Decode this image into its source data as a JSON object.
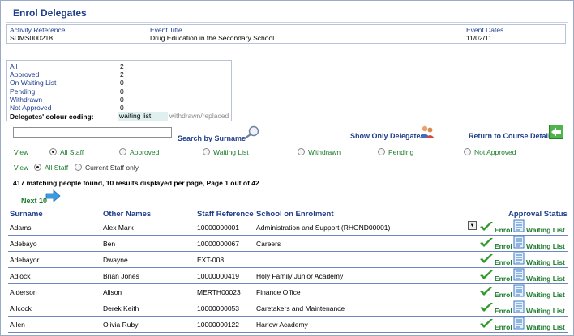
{
  "page": {
    "title": "Enrol Delegates"
  },
  "event": {
    "activity_ref_label": "Activity Reference",
    "activity_ref_value": "SDMS000218",
    "title_label": "Event Title",
    "title_value": "Drug Education in the Secondary School",
    "dates_label": "Event Dates",
    "dates_value": "11/02/11"
  },
  "stats": [
    {
      "label": "All",
      "value": "2"
    },
    {
      "label": "Approved",
      "value": "2"
    },
    {
      "label": "On Waiting List",
      "value": "0"
    },
    {
      "label": "Pending",
      "value": "0"
    },
    {
      "label": "Withdrawn",
      "value": "0"
    },
    {
      "label": "Not Approved",
      "value": "0"
    }
  ],
  "coding": {
    "label": "Delegates' colour coding:",
    "waiting": "waiting list",
    "withdrawn": "withdrawn/replaced",
    "waiting_color": "#dff0ee"
  },
  "search": {
    "value": "",
    "button_label": "Search by Surname"
  },
  "links": {
    "show_only": "Show Only Delegates",
    "return": "Return to Course Details",
    "next": "Next 10"
  },
  "filter1": {
    "label": "View",
    "options": [
      "All Staff",
      "Approved",
      "Waiting List",
      "Withdrawn",
      "Pending",
      "Not Approved"
    ],
    "selected": "All Staff"
  },
  "filter2": {
    "label": "View",
    "options": [
      "All Staff",
      "Current Staff only"
    ],
    "selected": "All Staff"
  },
  "summary": "417 matching people found, 10 results displayed per page, Page  1 out of  42",
  "table": {
    "headers": [
      "Surname",
      "Other Names",
      "Staff Reference",
      "School on Enrolment",
      "Approval Status"
    ],
    "enrol_label": "Enrol",
    "waiting_label": "Waiting List",
    "rows": [
      {
        "surname": "Adams",
        "other": "Alex Mark",
        "ref": "10000000001",
        "school": "Administration and Support (RHOND00001)"
      },
      {
        "surname": "Adebayo",
        "other": "Ben",
        "ref": "10000000067",
        "school": "Careers"
      },
      {
        "surname": "Adebayor",
        "other": "Dwayne",
        "ref": "EXT-008",
        "school": ""
      },
      {
        "surname": "Adlock",
        "other": "Brian Jones",
        "ref": "10000000419",
        "school": "Holy Family Junior Academy"
      },
      {
        "surname": "Alderson",
        "other": "Alison",
        "ref": "MERTH00023",
        "school": "Finance Office"
      },
      {
        "surname": "Allcock",
        "other": "Derek Keith",
        "ref": "10000000053",
        "school": "Caretakers and Maintenance"
      },
      {
        "surname": "Allen",
        "other": "Olivia Ruby",
        "ref": "10000000122",
        "school": "Harlow Academy"
      }
    ]
  },
  "colors": {
    "heading": "#1f3d8a",
    "green": "#1a7a2a",
    "row_rule": "#6e86c2"
  }
}
